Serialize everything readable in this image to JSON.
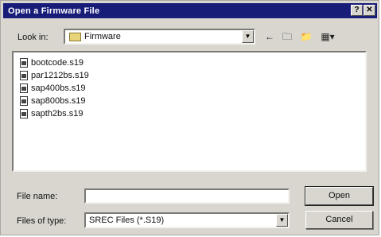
{
  "window": {
    "title": "Open a Firmware File",
    "help_glyph": "?",
    "close_glyph": "✕"
  },
  "toolbar": {
    "lookin_label": "Look in:",
    "lookin_value": "Firmware",
    "dropdown_glyph": "▼",
    "back_glyph": "←",
    "up_glyph": "🗀",
    "new_glyph": "📁",
    "view_glyph": "▦▾"
  },
  "files": [
    {
      "name": "bootcode.s19"
    },
    {
      "name": "par1212bs.s19"
    },
    {
      "name": "sap400bs.s19"
    },
    {
      "name": "sap800bs.s19"
    },
    {
      "name": "sapth2bs.s19"
    }
  ],
  "form": {
    "filename_label": "File name:",
    "filename_value": "",
    "filetype_label": "Files of type:",
    "filetype_value": "SREC Files (*.S19)"
  },
  "buttons": {
    "open_label": "Open",
    "cancel_label": "Cancel"
  },
  "colors": {
    "titlebar": "#171c78",
    "face": "#d8d6cf"
  }
}
